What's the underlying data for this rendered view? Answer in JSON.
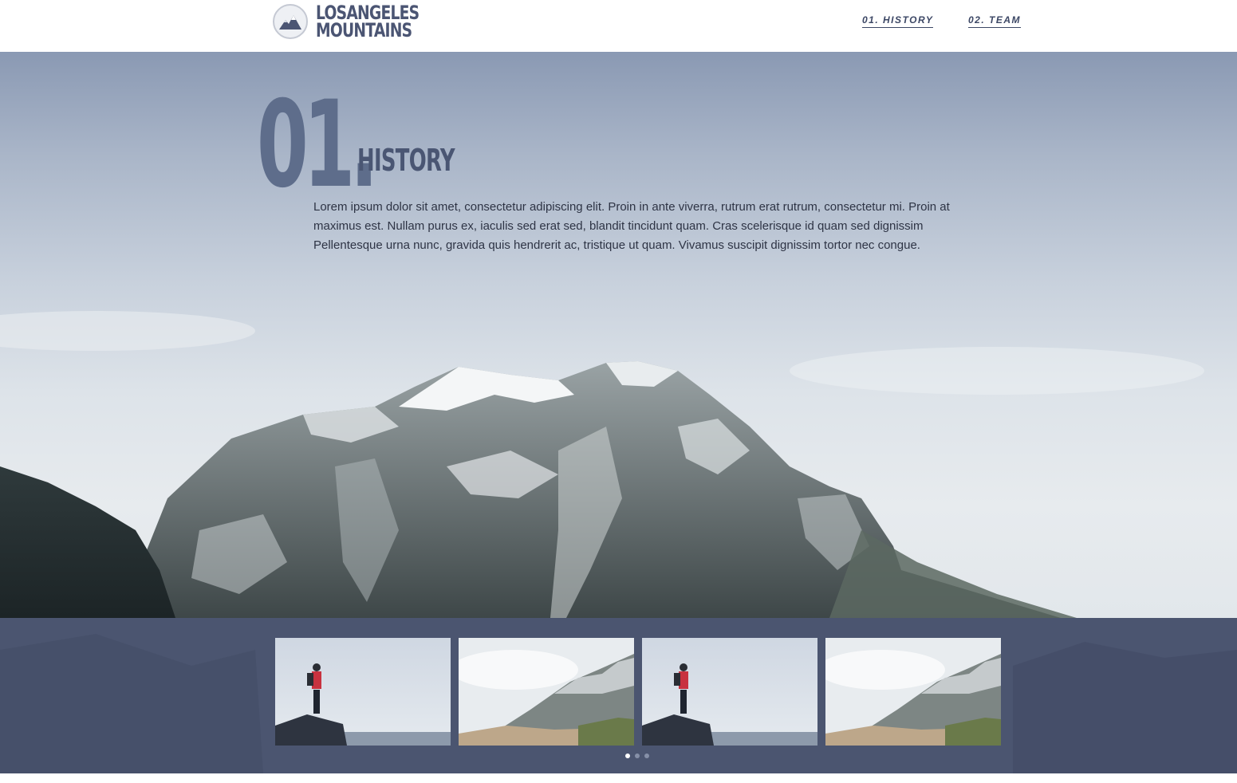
{
  "header": {
    "logo_line1": "LOSANGELES",
    "logo_line2": "MOUNTAINS",
    "nav": [
      {
        "label": "01. HISTORY"
      },
      {
        "label": "02. TEAM"
      }
    ]
  },
  "hero": {
    "number": "01.",
    "title": "HISTORY",
    "body": "Lorem ipsum dolor sit amet, consectetur adipiscing elit. Proin in ante viverra, rutrum erat rutrum, consectetur mi. Proin at maximus est. Nullam purus ex, iaculis sed erat sed, blandit tincidunt quam. Cras scelerisque id quam sed dignissim Pellentesque urna nunc, gravida quis hendrerit ac, tristique ut quam. Vivamus suscipit dignissim tortor nec congue."
  },
  "gallery": {
    "thumbnails": [
      {
        "icon": "hiker-on-rock-image"
      },
      {
        "icon": "misty-mountain-image"
      },
      {
        "icon": "hiker-on-rock-image"
      },
      {
        "icon": "misty-mountain-image"
      }
    ],
    "pages": 3,
    "active_page": 1
  },
  "colors": {
    "accent": "#4b5573",
    "gallery_band": "#4b5570",
    "big_number": "#5e6d8b"
  }
}
